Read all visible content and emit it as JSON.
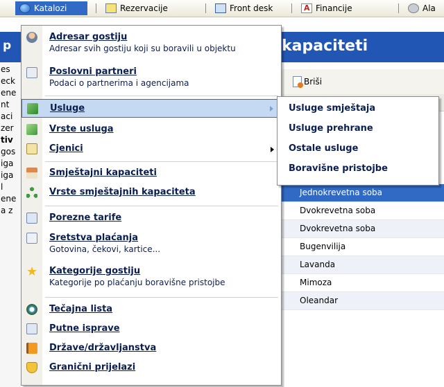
{
  "menubar": {
    "items": [
      {
        "label": "Katalozi",
        "icon": "globe-icon"
      },
      {
        "label": "Rezervacije",
        "icon": "reservation-icon"
      },
      {
        "label": "Front desk",
        "icon": "front-desk-icon"
      },
      {
        "label": "Financije",
        "icon": "finance-icon"
      },
      {
        "label": "Ala",
        "icon": "gear-icon"
      }
    ]
  },
  "background": {
    "left_header": "p",
    "left_strip": [
      "es",
      "eck",
      "ene",
      "nt",
      "aci",
      "zer",
      "tiv",
      "gos",
      "iga",
      "iga",
      "l",
      "ene",
      "a z"
    ],
    "title": "kapaciteti",
    "toolbar": {
      "delete_label": "Briši"
    },
    "rows": [
      "Jednokrevetna soba",
      "Dvokrevetna soba",
      "Dvokrevetna soba",
      "Bugenvilija",
      "Lavanda",
      "Mimoza",
      "Oleandar"
    ]
  },
  "dropdown": {
    "items": {
      "adresar": {
        "label": "Adresar gostiju",
        "desc": "Adresar svih gostiju koji su boravili u objektu"
      },
      "partneri": {
        "label": "Poslovni partneri",
        "desc": "Podaci o partnerima i agencijama"
      },
      "usluge": {
        "label": "Usluge"
      },
      "vrste_usluga": {
        "label": "Vrste usluga"
      },
      "cjenici": {
        "label": "Cjenici"
      },
      "smjestajni": {
        "label": "Smještajni kapaciteti"
      },
      "vrste_smjestajnih": {
        "label": "Vrste smještajnih kapaciteta"
      },
      "porezne": {
        "label": "Porezne tarife"
      },
      "sretstva": {
        "label": "Sretstva plaćanja",
        "desc": "Gotovina, čekovi, kartice..."
      },
      "kategorije": {
        "label": "Kategorije gostiju",
        "desc": "Kategorije po plaćanju boravišne pristojbe"
      },
      "tecajna": {
        "label": "Tečajna lista"
      },
      "putne": {
        "label": "Putne isprave"
      },
      "drzave": {
        "label": "Države/državljanstva"
      },
      "granicni": {
        "label": "Granični prijelazi"
      }
    }
  },
  "submenu": {
    "items": [
      "Usluge smještaja",
      "Usluge prehrane",
      "Ostale usluge",
      "Boravišne pristojbe"
    ]
  },
  "colors": {
    "selection": "#316ac5",
    "header_blue": "#2256b5",
    "menu_text": "#0a1e50",
    "highlight": "#c6d9f3"
  }
}
